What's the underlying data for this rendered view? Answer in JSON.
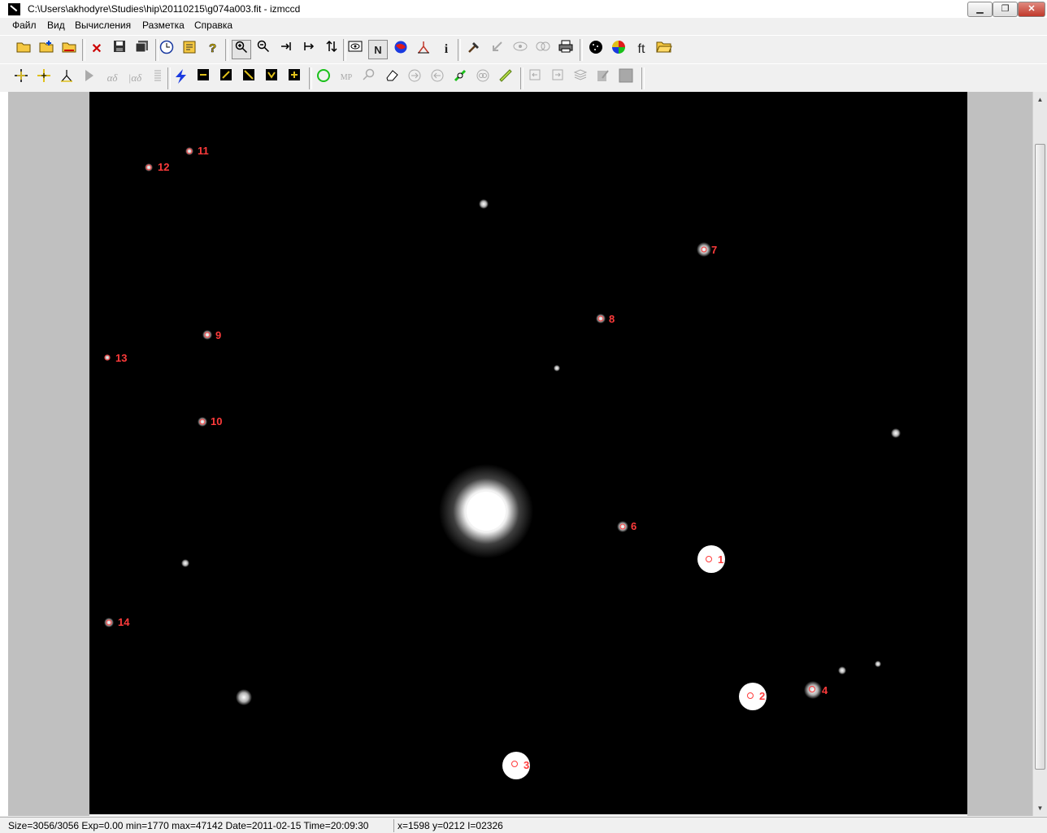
{
  "window": {
    "title": "C:\\Users\\akhodyre\\Studies\\hip\\20110215\\g074a003.fit - izmccd"
  },
  "menu": [
    "Файл",
    "Вид",
    "Вычисления",
    "Разметка",
    "Справка"
  ],
  "toolbar1_labels": {
    "north": "N",
    "info": "i",
    "ft": "ft"
  },
  "toolbar2_labels": {
    "alpha_delta": "αδ",
    "alpha_delta_2": "|αδ",
    "mp": "MP"
  },
  "colors": {
    "label": "#ff3b3b",
    "star": "#ffffff",
    "background": "#000000"
  },
  "stars": [
    {
      "label": "1"
    },
    {
      "label": "2"
    },
    {
      "label": "3"
    },
    {
      "label": "4"
    },
    {
      "label": "6"
    },
    {
      "label": "7"
    },
    {
      "label": "8"
    },
    {
      "label": "9"
    },
    {
      "label": "10"
    },
    {
      "label": "11"
    },
    {
      "label": "12"
    },
    {
      "label": "13"
    },
    {
      "label": "14"
    }
  ],
  "status": {
    "left": "Size=3056/3056 Exp=0.00 min=1770 max=47142 Date=2011-02-15 Time=20:09:30",
    "right": "x=1598 y=0212 I=02326"
  }
}
